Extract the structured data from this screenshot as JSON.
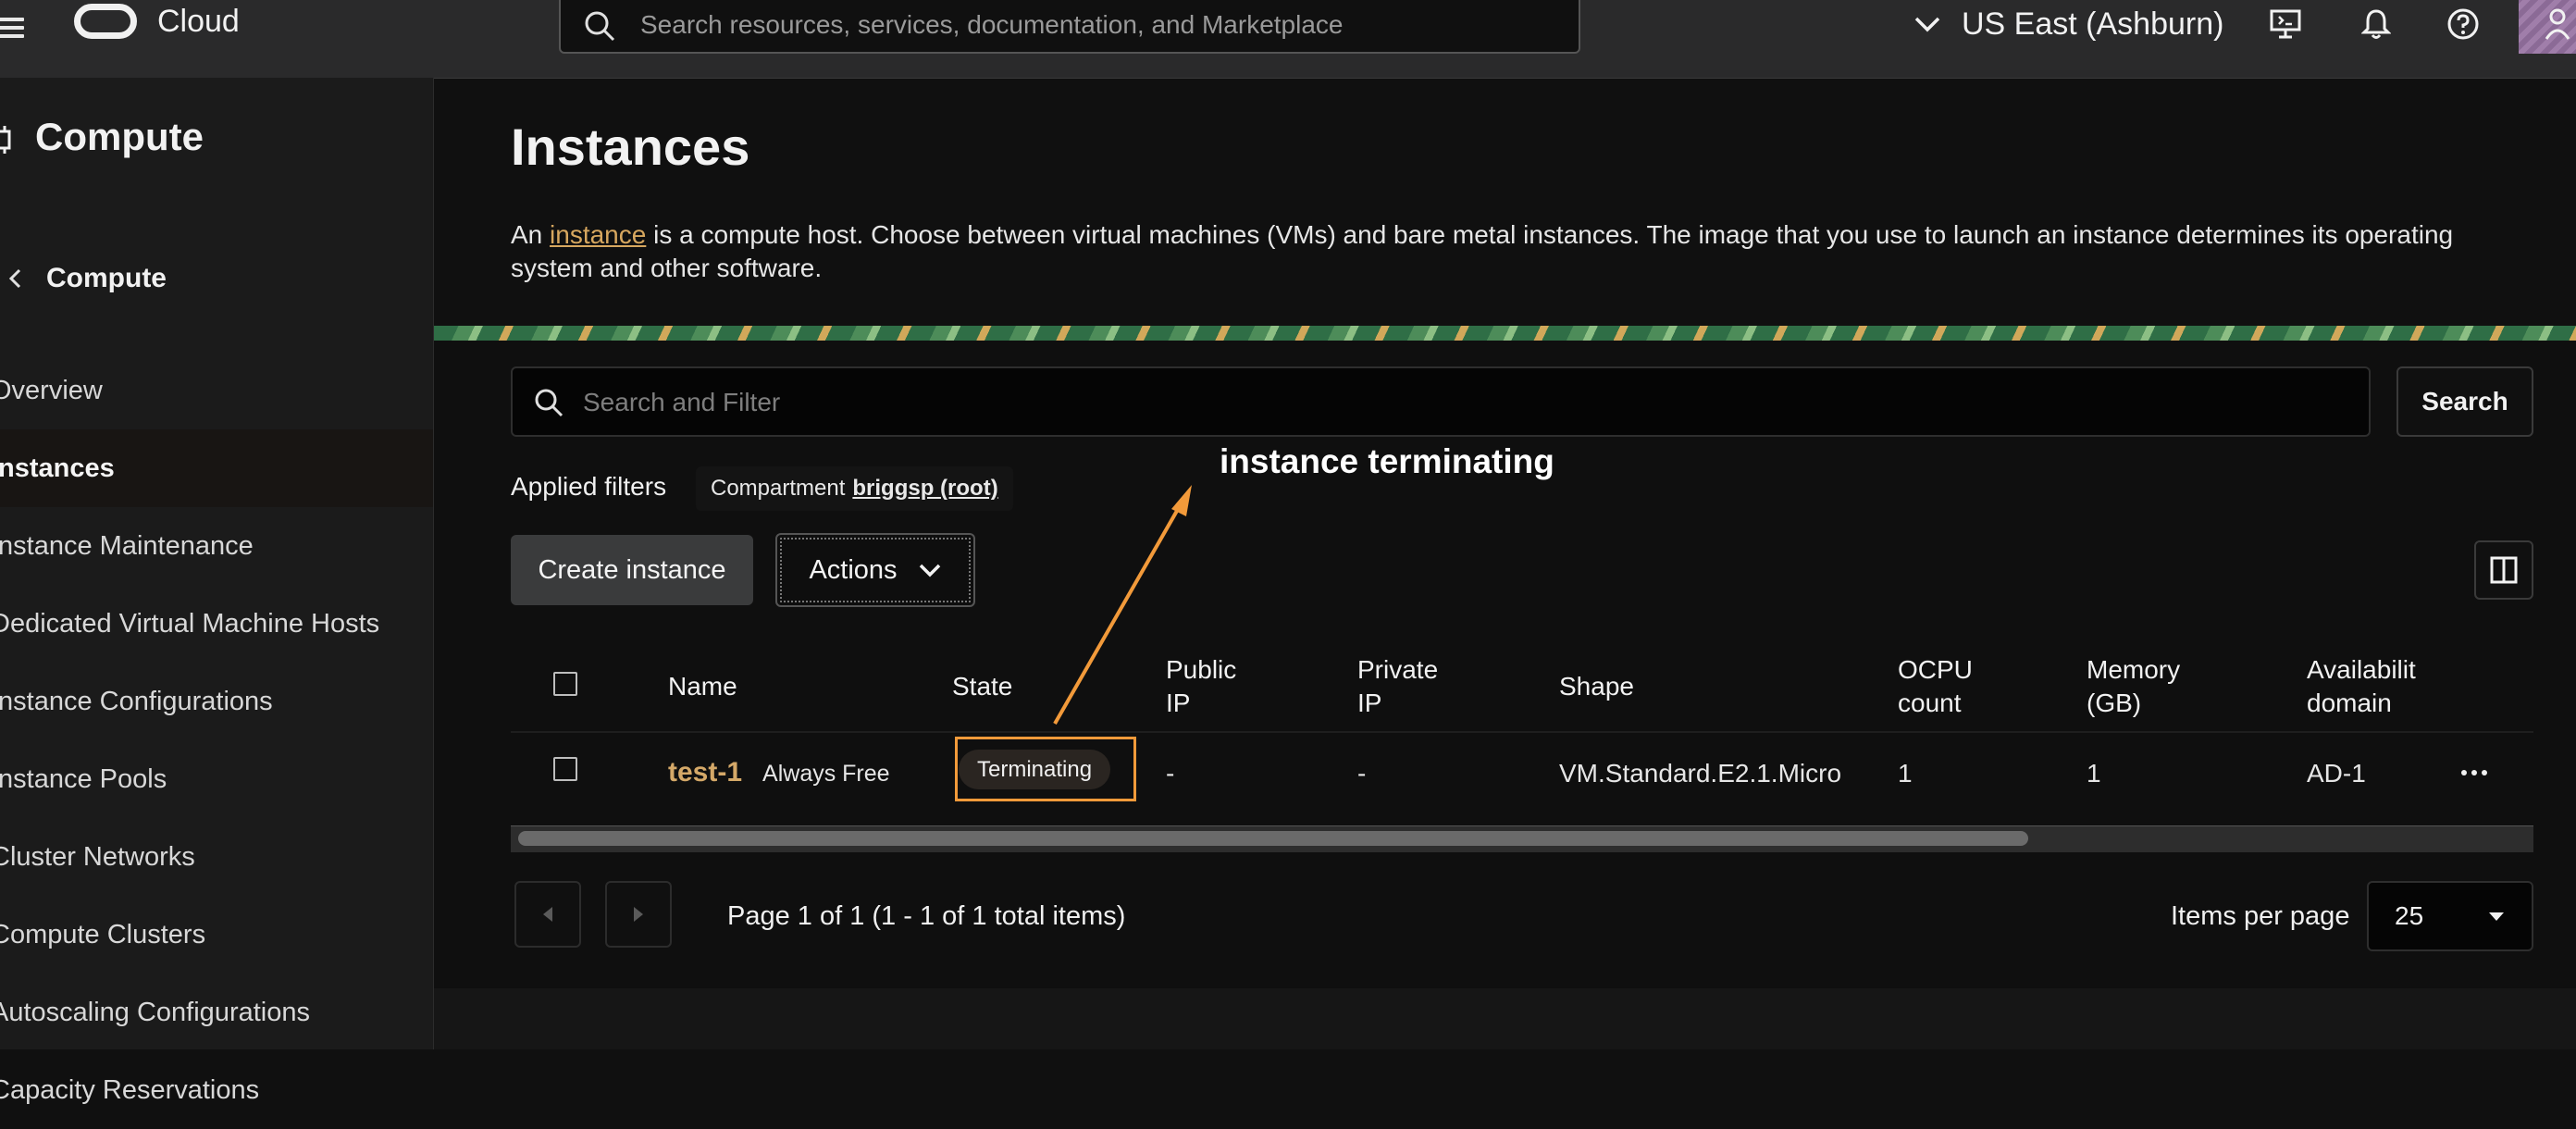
{
  "topbar": {
    "brand": "Cloud",
    "search_placeholder": "Search resources, services, documentation, and Marketplace",
    "region": "US East (Ashburn)"
  },
  "sidebar": {
    "title": "Compute",
    "back_label": "Compute",
    "items": [
      {
        "label": "Overview"
      },
      {
        "label": "Instances",
        "active": true
      },
      {
        "label": "Instance Maintenance"
      },
      {
        "label": "Dedicated Virtual Machine Hosts"
      },
      {
        "label": "Instance Configurations"
      },
      {
        "label": "Instance Pools"
      },
      {
        "label": "Cluster Networks"
      },
      {
        "label": "Compute Clusters"
      },
      {
        "label": "Autoscaling Configurations"
      },
      {
        "label": "Capacity Reservations"
      }
    ]
  },
  "main": {
    "title": "Instances",
    "desc_prefix": "An ",
    "desc_link": "instance",
    "desc_rest": " is a compute host. Choose between virtual machines (VMs) and bare metal instances. The image that you use to launch an instance determines its operating system and other software.",
    "filter_placeholder": "Search and Filter",
    "search_button": "Search",
    "applied_filters_label": "Applied filters",
    "compartment_label": "Compartment",
    "compartment_value": "briggsp (root)",
    "create_button": "Create instance",
    "actions_button": "Actions"
  },
  "table": {
    "headers": {
      "name": "Name",
      "state": "State",
      "public_ip_1": "Public",
      "public_ip_2": "IP",
      "private_ip_1": "Private",
      "private_ip_2": "IP",
      "shape": "Shape",
      "ocpu_1": "OCPU",
      "ocpu_2": "count",
      "memory_1": "Memory",
      "memory_2": "(GB)",
      "availability_1": "Availabilit",
      "availability_2": "domain"
    },
    "rows": [
      {
        "name": "test-1",
        "tag": "Always Free",
        "state": "Terminating",
        "public_ip": "-",
        "private_ip": "-",
        "shape": "VM.Standard.E2.1.Micro",
        "ocpu": "1",
        "memory": "1",
        "availability": "AD-1"
      }
    ]
  },
  "pagination": {
    "info": "Page 1 of 1 (1 - 1 of 1 total items)",
    "items_per_page_label": "Items per page",
    "items_per_page": "25"
  },
  "annotation": {
    "text": "instance terminating",
    "color": "#f29a3a"
  },
  "colors": {
    "accent_link": "#d7a75f",
    "background": "#101010",
    "topbar": "#2a2a2b"
  }
}
